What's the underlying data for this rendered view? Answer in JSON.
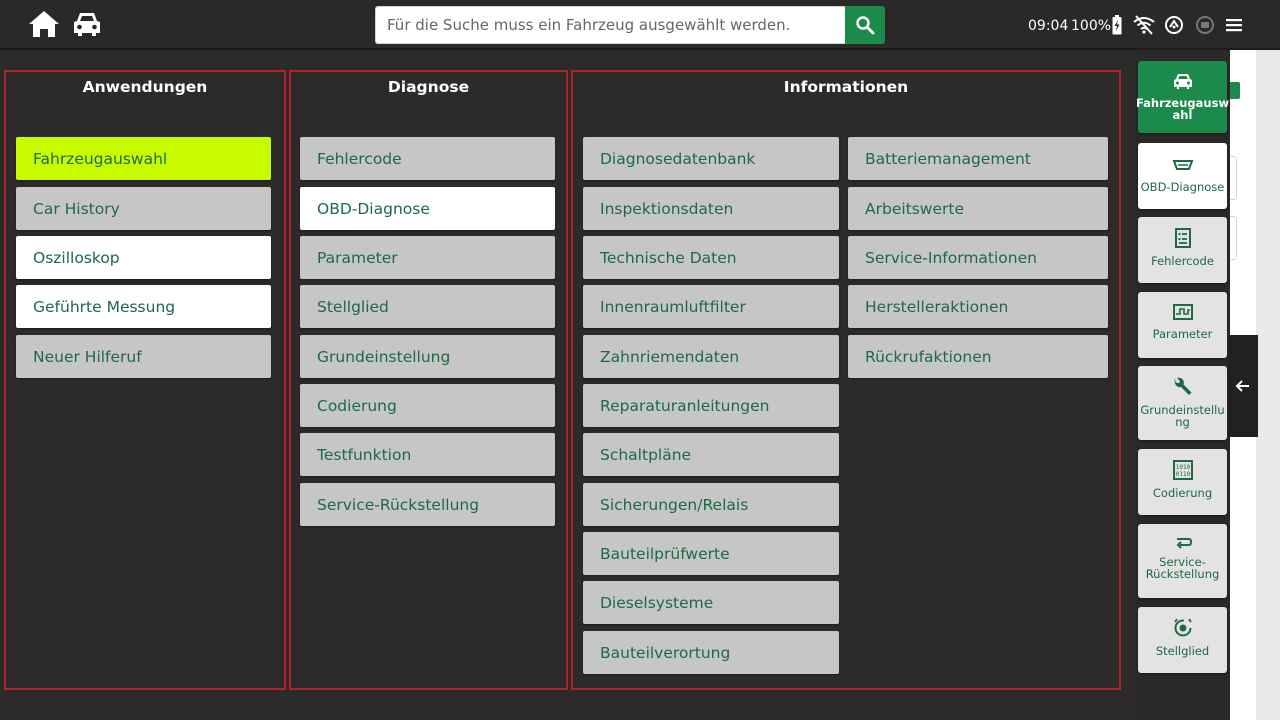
{
  "topbar": {
    "search_placeholder": "Für die Suche muss ein Fahrzeug ausgewählt werden.",
    "time": "09:04",
    "battery": "100%",
    "accent_color": "#1c8a4b"
  },
  "panels": {
    "anwendungen": {
      "title": "Anwendungen",
      "items": [
        "Fahrzeugauswahl",
        "Car History",
        "Oszilloskop",
        "Geführte Messung",
        "Neuer Hilferuf"
      ]
    },
    "diagnose": {
      "title": "Diagnose",
      "items": [
        "Fehlercode",
        "OBD-Diagnose",
        "Parameter",
        "Stellglied",
        "Grundeinstellung",
        "Codierung",
        "Testfunktion",
        "Service-Rückstellung"
      ]
    },
    "informationen": {
      "title": "Informationen",
      "col1": [
        "Diagnosedatenbank",
        "Inspektionsdaten",
        "Technische Daten",
        "Innenraumluftfilter",
        "Zahnriemendaten",
        "Reparaturanleitungen",
        "Schaltpläne",
        "Sicherungen/Relais",
        "Bauteilprüfwerte",
        "Dieselsysteme",
        "Bauteilverortung"
      ],
      "col2": [
        "Batteriemanagement",
        "Arbeitswerte",
        "Service-Informationen",
        "Herstelleraktionen",
        "Rückrufaktionen"
      ]
    }
  },
  "sidebar": {
    "items": [
      {
        "label_1": "Fahrzeugausw",
        "label_2": "ahl",
        "icon": "car-icon"
      },
      {
        "label_1": "OBD-Diagnose",
        "label_2": "",
        "icon": "obd-plug-icon"
      },
      {
        "label_1": "Fehlercode",
        "label_2": "",
        "icon": "checklist-icon"
      },
      {
        "label_1": "Parameter",
        "label_2": "",
        "icon": "waveform-icon"
      },
      {
        "label_1": "Grundeinstellu",
        "label_2": "ng",
        "icon": "wrench-icon"
      },
      {
        "label_1": "Codierung",
        "label_2": "",
        "icon": "binary-icon"
      },
      {
        "label_1": "Service-",
        "label_2": "Rückstellung",
        "icon": "reset-arrow-icon"
      },
      {
        "label_1": "Stellglied",
        "label_2": "",
        "icon": "actuator-icon"
      }
    ]
  }
}
